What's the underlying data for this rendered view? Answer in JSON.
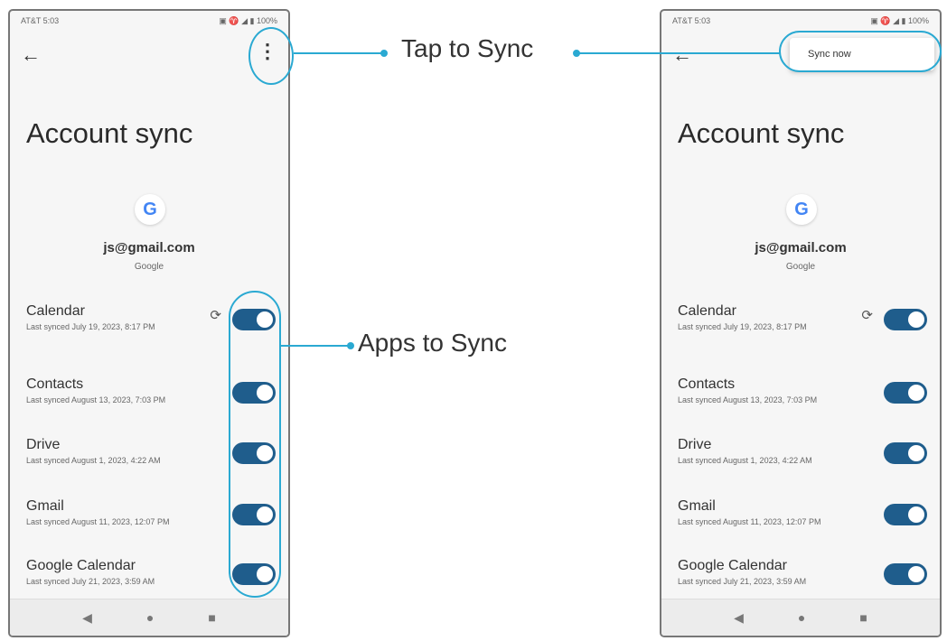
{
  "phone": {
    "status_left": "AT&T 5:03",
    "status_right": "▣ ♈ ◢ ▮ 100%",
    "title": "Account sync",
    "google_logo": "G",
    "email": "js@gmail.com",
    "account_type": "Google",
    "menu_item": "Sync now",
    "items": [
      {
        "name": "Calendar",
        "sub": "Last synced July 19, 2023, 8:17 PM",
        "sync_icon": true,
        "on": true
      },
      {
        "name": "Contacts",
        "sub": "Last synced August 13, 2023, 7:03 PM",
        "on": true
      },
      {
        "name": "Drive",
        "sub": "Last synced August 1, 2023, 4:22 AM",
        "on": true
      },
      {
        "name": "Gmail",
        "sub": "Last synced August 11, 2023, 12:07 PM",
        "on": true
      },
      {
        "name": "Google Calendar",
        "sub": "Last synced July 21, 2023, 3:59 AM",
        "on": true
      }
    ],
    "nav": {
      "back": "◀",
      "home": "●",
      "recents": "■"
    }
  },
  "callouts": {
    "tap_to_sync": "Tap to Sync",
    "apps_to_sync": "Apps to Sync"
  },
  "colors": {
    "accent": "#2aa9d2",
    "toggle": "#1f5d8c"
  },
  "icons": {
    "back": "arrow-left-icon",
    "menu": "more-vert-icon",
    "sync": "sync-icon",
    "google": "google-logo-icon"
  }
}
